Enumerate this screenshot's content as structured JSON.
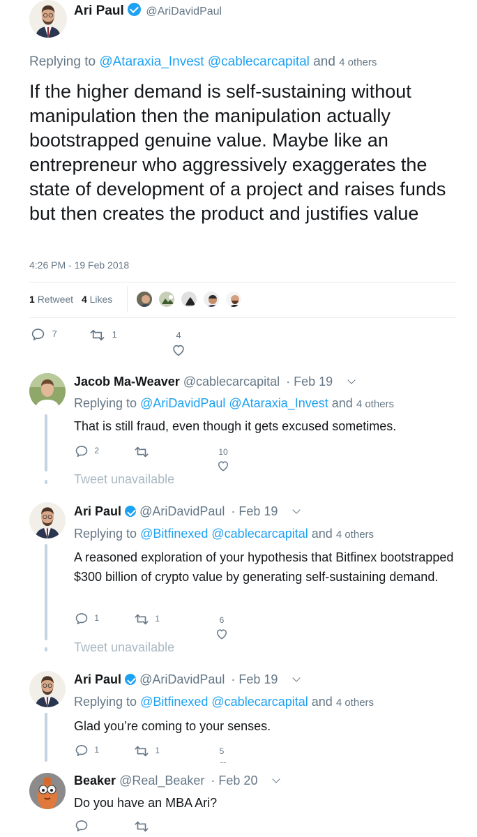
{
  "main_tweet": {
    "name": "Ari Paul",
    "handle": "@AriDavidPaul",
    "replying_prefix": "Replying to",
    "replying_users": "@Ataraxia_Invest @cablecarcapital",
    "replying_and": "and",
    "replying_others": "4 others",
    "text": "If the higher demand is self-sustaining without manipulation then the manipulation actually bootstrapped genuine value.  Maybe like an entrepreneur who aggressively exaggerates the state of development of a project and raises funds but then creates the product and justifies value",
    "timestamp": "4:26 PM - 19 Feb 2018",
    "retweet_count": "1",
    "retweet_label": "Retweet",
    "likes_count": "4",
    "likes_label": "Likes",
    "reply_count": "7",
    "retweets": "1",
    "likes": "4"
  },
  "replies": [
    {
      "name": "Jacob Ma-Weaver",
      "handle": "@cablecarcapital",
      "date": "· Feb 19",
      "replying_prefix": "Replying to",
      "replying_users": "@AriDavidPaul @Ataraxia_Invest",
      "replying_and": "and",
      "replying_others": "4 others",
      "text": "That is still fraud, even though it gets excused sometimes.",
      "reply_count": "2",
      "retweets": "",
      "likes": "10",
      "unavailable": "Tweet unavailable"
    },
    {
      "name": "Ari Paul",
      "handle": "@AriDavidPaul",
      "date": "· Feb 19",
      "replying_prefix": "Replying to",
      "replying_users": "@Bitfinexed @cablecarcapital",
      "replying_and": "and",
      "replying_others": "4 others",
      "text": "A reasoned exploration of your hypothesis that Bitfinex bootstrapped $300 billion of crypto value by generating self-sustaining demand.",
      "reply_count": "1",
      "retweets": "1",
      "likes": "6",
      "unavailable": "Tweet unavailable"
    },
    {
      "name": "Ari Paul",
      "handle": "@AriDavidPaul",
      "date": "· Feb 19",
      "replying_prefix": "Replying to",
      "replying_users": "@Bitfinexed @cablecarcapital",
      "replying_and": "and",
      "replying_others": "4 others",
      "text": "Glad you’re coming to your senses.",
      "reply_count": "1",
      "retweets": "1",
      "likes": "5"
    },
    {
      "name": "Beaker",
      "handle": "@Real_Beaker",
      "date": "· Feb 20",
      "text": "Do you have an MBA Ari?"
    }
  ],
  "icons": {
    "reply": "reply-icon",
    "retweet": "retweet-icon",
    "like": "heart-icon",
    "verified": "verified-badge-icon",
    "caret": "chevron-down-icon"
  },
  "colors": {
    "link": "#1da1f2",
    "secondary": "#657786",
    "thread_line": "#c4d3e0"
  }
}
